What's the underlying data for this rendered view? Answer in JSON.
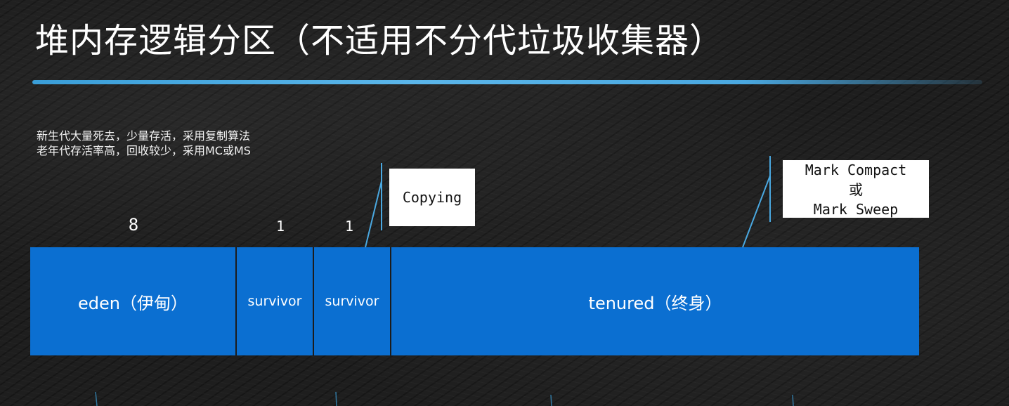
{
  "title": "堆内存逻辑分区（不适用不分代垃圾收集器）",
  "notes": [
    "新生代大量死去，少量存活，采用复制算法",
    "老年代存活率高，回收较少，采用MC或MS"
  ],
  "ratios": {
    "eden": "8",
    "survivor1": "1",
    "survivor2": "1"
  },
  "regions": {
    "eden": "eden（伊甸）",
    "survivor1": "survivor",
    "survivor2": "survivor",
    "tenured": "tenured（终身）"
  },
  "callouts": {
    "copying": "Copying",
    "mark_compact": "Mark Compact",
    "or": "或",
    "mark_sweep": "Mark Sweep"
  },
  "colors": {
    "region_fill": "#0b6fd1",
    "accent_line": "#4aa8e0"
  }
}
